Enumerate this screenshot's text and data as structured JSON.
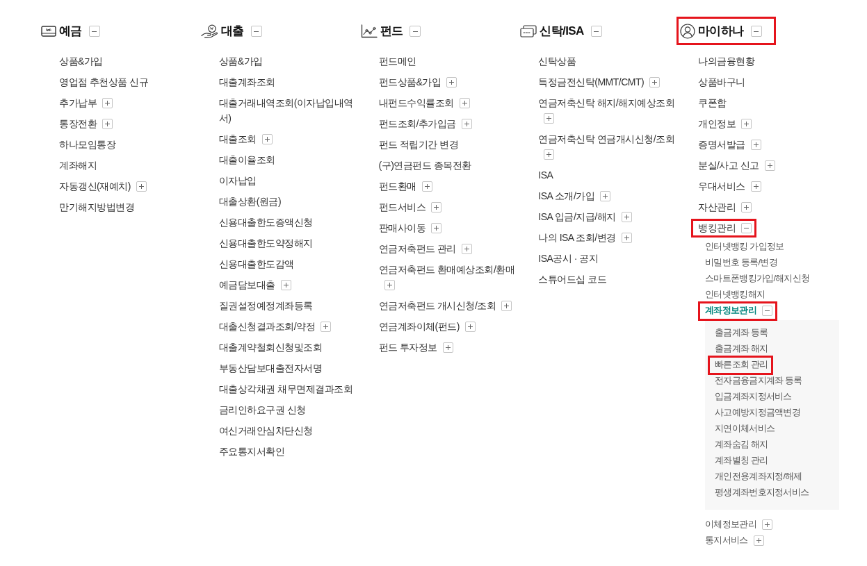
{
  "columns": [
    {
      "title": "예금",
      "expanded": true,
      "highlighted": false,
      "items": [
        {
          "label": "상품&가입",
          "selected": false,
          "highlighted": false
        },
        {
          "label": "영업점 추천상품 신규",
          "selected": false,
          "highlighted": false
        },
        {
          "label": "추가납부",
          "expanded": false,
          "selected": false,
          "highlighted": false
        },
        {
          "label": "통장전환",
          "expanded": false,
          "selected": false,
          "highlighted": false
        },
        {
          "label": "하나모임통장",
          "selected": false,
          "highlighted": false
        },
        {
          "label": "계좌해지",
          "selected": false,
          "highlighted": false
        },
        {
          "label": "자동갱신(재예치)",
          "expanded": false,
          "selected": false,
          "highlighted": false
        },
        {
          "label": "만기해지방법변경",
          "selected": false,
          "highlighted": false
        }
      ]
    },
    {
      "title": "대출",
      "expanded": true,
      "highlighted": false,
      "items": [
        {
          "label": "상품&가입",
          "selected": false,
          "highlighted": false
        },
        {
          "label": "대출계좌조회",
          "selected": false,
          "highlighted": false
        },
        {
          "label": "대출거래내역조회(이자납입내역서)",
          "selected": false,
          "highlighted": false
        },
        {
          "label": "대출조회",
          "expanded": false,
          "selected": false,
          "highlighted": false
        },
        {
          "label": "대출이율조회",
          "selected": false,
          "highlighted": false
        },
        {
          "label": "이자납입",
          "selected": false,
          "highlighted": false
        },
        {
          "label": "대출상환(원금)",
          "selected": false,
          "highlighted": false
        },
        {
          "label": "신용대출한도증액신청",
          "selected": false,
          "highlighted": false
        },
        {
          "label": "신용대출한도약정해지",
          "selected": false,
          "highlighted": false
        },
        {
          "label": "신용대출한도감액",
          "selected": false,
          "highlighted": false
        },
        {
          "label": "예금담보대출",
          "expanded": false,
          "selected": false,
          "highlighted": false
        },
        {
          "label": "질권설정예정계좌등록",
          "selected": false,
          "highlighted": false
        },
        {
          "label": "대출신청결과조회/약정",
          "expanded": false,
          "selected": false,
          "highlighted": false
        },
        {
          "label": "대출계약철회신청및조회",
          "selected": false,
          "highlighted": false
        },
        {
          "label": "부동산담보대출전자서명",
          "selected": false,
          "highlighted": false
        },
        {
          "label": "대출상각채권 채무면제결과조회",
          "selected": false,
          "highlighted": false
        },
        {
          "label": "금리인하요구권 신청",
          "selected": false,
          "highlighted": false
        },
        {
          "label": "여신거래안심차단신청",
          "selected": false,
          "highlighted": false
        },
        {
          "label": "주요통지서확인",
          "selected": false,
          "highlighted": false
        }
      ]
    },
    {
      "title": "펀드",
      "expanded": true,
      "highlighted": false,
      "items": [
        {
          "label": "펀드메인",
          "selected": false,
          "highlighted": false
        },
        {
          "label": "펀드상품&가입",
          "expanded": false,
          "selected": false,
          "highlighted": false
        },
        {
          "label": "내펀드수익률조회",
          "expanded": false,
          "selected": false,
          "highlighted": false
        },
        {
          "label": "펀드조회/추가입금",
          "expanded": false,
          "selected": false,
          "highlighted": false
        },
        {
          "label": "펀드 적립기간 변경",
          "selected": false,
          "highlighted": false
        },
        {
          "label": "(구)연금펀드 종목전환",
          "selected": false,
          "highlighted": false
        },
        {
          "label": "펀드환매",
          "expanded": false,
          "selected": false,
          "highlighted": false
        },
        {
          "label": "펀드서비스",
          "expanded": false,
          "selected": false,
          "highlighted": false
        },
        {
          "label": "판매사이동",
          "expanded": false,
          "selected": false,
          "highlighted": false
        },
        {
          "label": "연금저축펀드 관리",
          "expanded": false,
          "selected": false,
          "highlighted": false
        },
        {
          "label": "연금저축펀드 환매예상조회/환매",
          "expanded": false,
          "selected": false,
          "highlighted": false
        },
        {
          "label": "연금저축펀드 개시신청/조회",
          "expanded": false,
          "selected": false,
          "highlighted": false
        },
        {
          "label": "연금계좌이체(펀드)",
          "expanded": false,
          "selected": false,
          "highlighted": false
        },
        {
          "label": "펀드 투자정보",
          "expanded": false,
          "selected": false,
          "highlighted": false
        }
      ]
    },
    {
      "title": "신탁/ISA",
      "expanded": true,
      "highlighted": false,
      "items": [
        {
          "label": "신탁상품",
          "selected": false,
          "highlighted": false
        },
        {
          "label": "특정금전신탁(MMT/CMT)",
          "expanded": false,
          "selected": false,
          "highlighted": false
        },
        {
          "label": "연금저축신탁 해지/해지예상조회",
          "expanded": false,
          "selected": false,
          "highlighted": false
        },
        {
          "label": "연금저축신탁 연금개시신청/조회",
          "expanded": false,
          "selected": false,
          "highlighted": false
        },
        {
          "label": "ISA",
          "selected": false,
          "highlighted": false
        },
        {
          "label": "ISA 소개/가입",
          "expanded": false,
          "selected": false,
          "highlighted": false
        },
        {
          "label": "ISA 입금/지급/해지",
          "expanded": false,
          "selected": false,
          "highlighted": false
        },
        {
          "label": "나의 ISA 조회/변경",
          "expanded": false,
          "selected": false,
          "highlighted": false
        },
        {
          "label": "ISA공시 · 공지",
          "selected": false,
          "highlighted": false
        },
        {
          "label": "스튜어드십 코드",
          "selected": false,
          "highlighted": false
        }
      ]
    },
    {
      "title": "마이하나",
      "expanded": true,
      "highlighted": true,
      "items": [
        {
          "label": "나의금융현황",
          "selected": false,
          "highlighted": false
        },
        {
          "label": "상품바구니",
          "selected": false,
          "highlighted": false
        },
        {
          "label": "쿠폰함",
          "selected": false,
          "highlighted": false
        },
        {
          "label": "개인정보",
          "expanded": false,
          "selected": false,
          "highlighted": false
        },
        {
          "label": "증명서발급",
          "expanded": false,
          "selected": false,
          "highlighted": false
        },
        {
          "label": "분실/사고 신고",
          "expanded": false,
          "selected": false,
          "highlighted": false
        },
        {
          "label": "우대서비스",
          "expanded": false,
          "selected": false,
          "highlighted": false
        },
        {
          "label": "자산관리",
          "expanded": false,
          "selected": false,
          "highlighted": false
        },
        {
          "label": "뱅킹관리",
          "expanded": true,
          "selected": false,
          "highlighted": true,
          "children": [
            {
              "label": "인터넷뱅킹 가입정보",
              "selected": false,
              "highlighted": false
            },
            {
              "label": "비밀번호 등록/변경",
              "selected": false,
              "highlighted": false
            },
            {
              "label": "스마트폰뱅킹가입/해지신청",
              "selected": false,
              "highlighted": false
            },
            {
              "label": "인터넷뱅킹해지",
              "selected": false,
              "highlighted": false
            },
            {
              "label": "계좌정보관리",
              "expanded": true,
              "selected": true,
              "highlighted": true,
              "children": [
                {
                  "label": "출금계좌 등록",
                  "selected": false,
                  "highlighted": false
                },
                {
                  "label": "출금계좌 해지",
                  "selected": false,
                  "highlighted": false
                },
                {
                  "label": "빠른조회 관리",
                  "selected": false,
                  "highlighted": true
                },
                {
                  "label": "전자금융금지계좌 등록",
                  "selected": false,
                  "highlighted": false
                },
                {
                  "label": "입금계좌지정서비스",
                  "selected": false,
                  "highlighted": false
                },
                {
                  "label": "사고예방지정금액변경",
                  "selected": false,
                  "highlighted": false
                },
                {
                  "label": "지연이체서비스",
                  "selected": false,
                  "highlighted": false
                },
                {
                  "label": "계좌숨김 해지",
                  "selected": false,
                  "highlighted": false
                },
                {
                  "label": "계좌별칭 관리",
                  "selected": false,
                  "highlighted": false
                },
                {
                  "label": "개인전용계좌지정/해제",
                  "selected": false,
                  "highlighted": false
                },
                {
                  "label": "평생계좌번호지정서비스",
                  "selected": false,
                  "highlighted": false
                }
              ]
            },
            {
              "label": "이체정보관리",
              "expanded": false,
              "selected": false,
              "highlighted": false
            },
            {
              "label": "통지서비스",
              "expanded": false,
              "selected": false,
              "highlighted": false
            }
          ]
        }
      ]
    }
  ]
}
